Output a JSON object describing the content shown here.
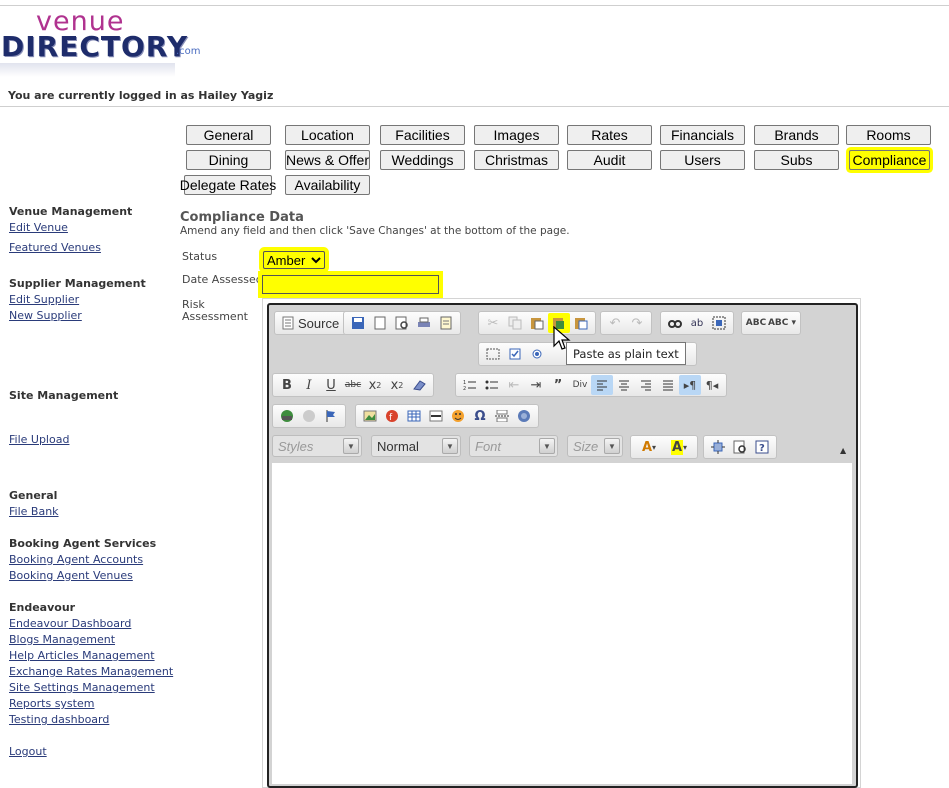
{
  "logo": {
    "venue": "venue",
    "directory": "DIRECTORY",
    "dotcom": ".com"
  },
  "header": {
    "logged_in": "You are currently logged in as Hailey Yagiz"
  },
  "tabs": [
    {
      "label": "General",
      "active": false
    },
    {
      "label": "Location",
      "active": false
    },
    {
      "label": "Facilities",
      "active": false
    },
    {
      "label": "Images",
      "active": false
    },
    {
      "label": "Rates",
      "active": false
    },
    {
      "label": "Financials",
      "active": false
    },
    {
      "label": "Brands",
      "active": false
    },
    {
      "label": "Rooms",
      "active": false
    },
    {
      "label": "Dining",
      "active": false
    },
    {
      "label": "News & Offer",
      "active": false
    },
    {
      "label": "Weddings",
      "active": false
    },
    {
      "label": "Christmas",
      "active": false
    },
    {
      "label": "Audit",
      "active": false
    },
    {
      "label": "Users",
      "active": false
    },
    {
      "label": "Subs",
      "active": false
    },
    {
      "label": "Compliance",
      "active": true
    },
    {
      "label": "Delegate Rates",
      "active": false
    },
    {
      "label": "Availability",
      "active": false
    }
  ],
  "sidebar": {
    "venue_management": "Venue Management",
    "edit_venue": "Edit Venue",
    "featured_venues": "Featured Venues",
    "supplier_management": "Supplier Management",
    "edit_supplier": "Edit Supplier",
    "new_supplier": "New Supplier",
    "site_management": "Site Management",
    "file_upload": "File Upload",
    "general": "General",
    "file_bank": "File Bank",
    "booking_agent_services": "Booking Agent Services",
    "booking_agent_accounts": "Booking Agent Accounts",
    "booking_agent_venues": "Booking Agent Venues",
    "endeavour": "Endeavour",
    "endeavour_dashboard": "Endeavour Dashboard",
    "blogs_management": "Blogs Management",
    "help_articles_management": "Help Articles Management",
    "exchange_rates_management": "Exchange Rates Management",
    "site_settings_management": "Site Settings Management",
    "reports_system": "Reports system",
    "testing_dashboard": "Testing dashboard",
    "logout": "Logout"
  },
  "form": {
    "title": "Compliance Data",
    "subtitle": "Amend any field and then click 'Save Changes' at the bottom of the page.",
    "status_label": "Status",
    "status_value": "Amber",
    "date_label": "Date Assessed",
    "date_value": "",
    "risk_label_1": "Risk",
    "risk_label_2": "Assessment"
  },
  "editor": {
    "source_label": "Source",
    "styles_placeholder": "Styles",
    "format_value": "Normal",
    "font_placeholder": "Font",
    "size_placeholder": "Size",
    "tooltip": "Paste as plain text"
  },
  "colors": {
    "highlight": "#ffff00",
    "link": "#2a3b7a",
    "logo_purple": "#b0328f",
    "logo_navy": "#1e2c6b"
  }
}
